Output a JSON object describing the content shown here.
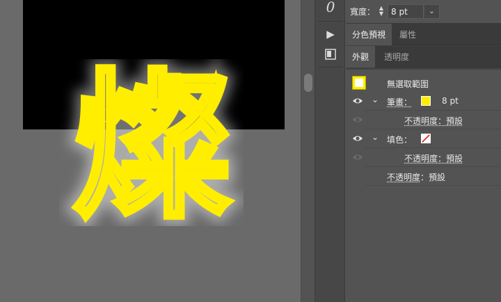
{
  "canvas": {
    "artwork_text": "燦",
    "colors": {
      "artboard": "#000000",
      "pasteboard": "#6a6a6a",
      "stroke": "#ffee00"
    }
  },
  "icon_strip": {
    "items": [
      {
        "name": "glyph-icon",
        "glyph": "0"
      },
      {
        "name": "play-icon",
        "glyph": "▶"
      },
      {
        "name": "artboard-panel-icon",
        "glyph": "◧"
      }
    ]
  },
  "panel": {
    "stroke_width_label": "寬度：",
    "stroke_width_value": "8 pt",
    "top_tabs": [
      "分色預視",
      "屬性"
    ],
    "sub_tabs": [
      "外觀",
      "透明度"
    ],
    "appearance": {
      "header": "無選取範圍",
      "stroke_label": "筆畫：",
      "stroke_weight": "8 pt",
      "stroke_opacity": "不透明度：預設",
      "fill_label": "填色：",
      "fill_opacity": "不透明度：預設",
      "object_opacity_label": "不透明度",
      "object_opacity_value": "：預設"
    },
    "colors": {
      "stroke_swatch": "#ffee00",
      "fill_swatch_slash": "#d62a2a"
    }
  }
}
